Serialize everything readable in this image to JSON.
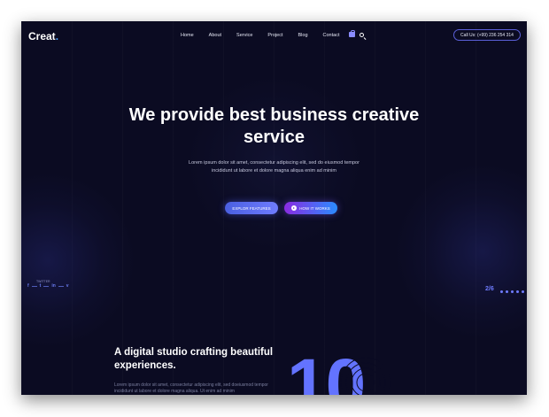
{
  "header": {
    "logo": "Creat",
    "logo_dot": ".",
    "nav": [
      "Home",
      "About",
      "Service",
      "Project",
      "Blog",
      "Contact"
    ],
    "call_label": "Call Us: (+99) 236 254 314"
  },
  "hero": {
    "title": "We provide best business creative service",
    "description": "Lorem ipsum dolor sit amet, consectetur adipiscing elit, sed do eiusmod tempor incididunt ut labore et dolore magna aliqua enim ad minim",
    "explore_label": "EXPLOR FEATURES",
    "how_label": "HOW IT WORKS"
  },
  "social": {
    "label": "TWITTER",
    "icons": [
      "f",
      "t",
      "in",
      "v"
    ]
  },
  "slider": {
    "counter": "2/6"
  },
  "about": {
    "title": "A digital studio crafting beautiful experiences.",
    "description": "Lorem ipsum dolor sit amet, consectetur adipiscing elit, sed doeiusmod tempor incididunt ut labore et dolore magna aliqua. Ut enim ad minim",
    "big_number": "10"
  },
  "colors": {
    "background": "#0b0b22",
    "accent": "#6373ff",
    "gradient_start": "#8a2be2",
    "gradient_end": "#2a8cff"
  },
  "icons": [
    "bag-icon",
    "search-icon",
    "play-icon",
    "facebook-icon",
    "twitter-icon",
    "linkedin-icon",
    "vimeo-icon"
  ]
}
